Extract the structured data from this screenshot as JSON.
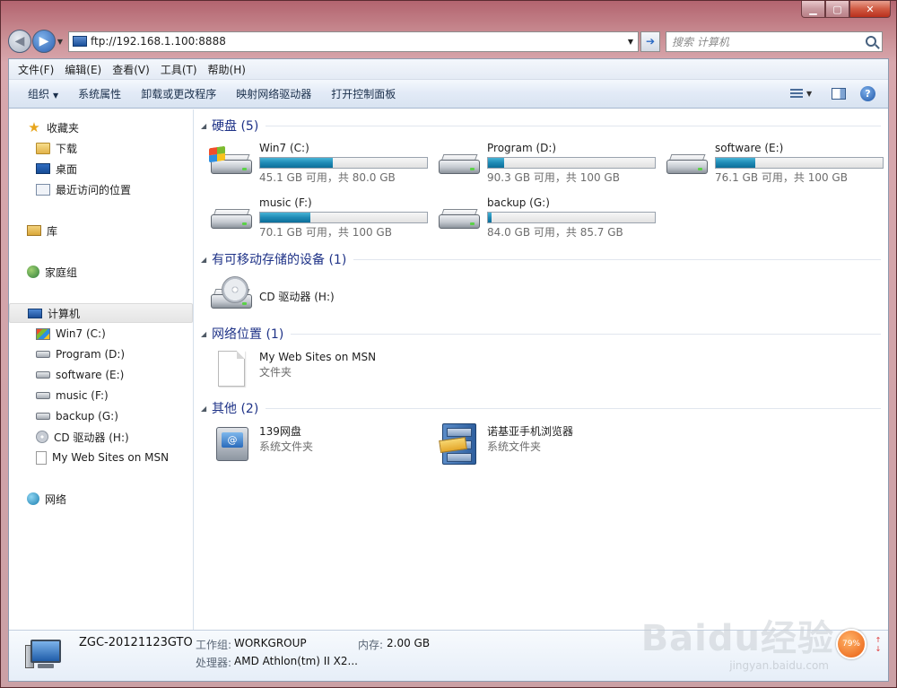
{
  "address": {
    "url": "ftp://192.168.1.100:8888"
  },
  "search": {
    "placeholder": "搜索 计算机"
  },
  "menu": [
    "文件(F)",
    "编辑(E)",
    "查看(V)",
    "工具(T)",
    "帮助(H)"
  ],
  "toolbar": {
    "organize": "组织",
    "items": [
      "系统属性",
      "卸载或更改程序",
      "映射网络驱动器",
      "打开控制面板"
    ]
  },
  "sidebar": {
    "favorites": {
      "label": "收藏夹",
      "items": [
        "下载",
        "桌面",
        "最近访问的位置"
      ]
    },
    "libraries": "库",
    "homegroup": "家庭组",
    "computer": {
      "label": "计算机",
      "items": [
        "Win7 (C:)",
        "Program (D:)",
        "software (E:)",
        "music (F:)",
        "backup (G:)",
        "CD 驱动器 (H:)",
        "My Web Sites on MSN"
      ]
    },
    "network": "网络"
  },
  "groups": {
    "hdd": "硬盘 (5)",
    "removable": "有可移动存储的设备 (1)",
    "network": "网络位置 (1)",
    "other": "其他 (2)"
  },
  "drives": [
    {
      "name": "Win7 (C:)",
      "space": "45.1 GB 可用，共 80.0 GB",
      "used_pct": 43.6
    },
    {
      "name": "Program (D:)",
      "space": "90.3 GB 可用，共 100 GB",
      "used_pct": 9.7
    },
    {
      "name": "software (E:)",
      "space": "76.1 GB 可用，共 100 GB",
      "used_pct": 23.9
    },
    {
      "name": "music (F:)",
      "space": "70.1 GB 可用，共 100 GB",
      "used_pct": 29.9
    },
    {
      "name": "backup (G:)",
      "space": "84.0 GB 可用，共 85.7 GB",
      "used_pct": 2.0
    }
  ],
  "removable": {
    "name": "CD 驱动器 (H:)"
  },
  "network_location": {
    "name": "My Web Sites on MSN",
    "type": "文件夹"
  },
  "other": [
    {
      "name": "139网盘",
      "type": "系统文件夹"
    },
    {
      "name": "诺基亚手机浏览器",
      "type": "系统文件夹"
    }
  ],
  "details": {
    "computer_name": "ZGC-20121123GTO",
    "workgroup_label": "工作组:",
    "workgroup": "WORKGROUP",
    "memory_label": "内存:",
    "memory": "2.00 GB",
    "cpu_label": "处理器:",
    "cpu": "AMD Athlon(tm) II X2..."
  },
  "watermark": {
    "brand": "Baidu经验",
    "site": "jingyan.baidu.com",
    "badge": "79%"
  },
  "colors": {
    "group_title": "#1e3287",
    "bar_fill": "#1f8ab5",
    "frame": "#c98d93"
  }
}
